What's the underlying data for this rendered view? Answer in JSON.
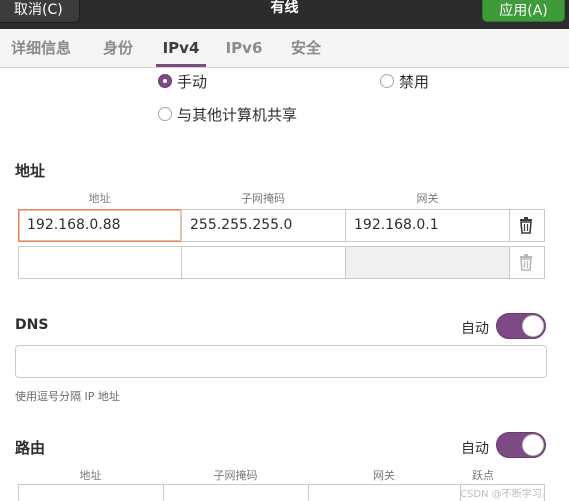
{
  "header": {
    "cancel_label": "取消(C)",
    "title": "有线",
    "apply_label": "应用(A)",
    "apply_color": "#3f9a3a"
  },
  "tabs": [
    {
      "label": "详细信息",
      "active": false
    },
    {
      "label": "身份",
      "active": false
    },
    {
      "label": "IPv4",
      "active": true
    },
    {
      "label": "IPv6",
      "active": false
    },
    {
      "label": "安全",
      "active": false
    }
  ],
  "method": {
    "options": [
      {
        "label": "手动",
        "selected": true
      },
      {
        "label": "禁用",
        "selected": false
      },
      {
        "label": "与其他计算机共享",
        "selected": false
      }
    ]
  },
  "addresses": {
    "heading": "地址",
    "columns": [
      "地址",
      "子网掩码",
      "网关"
    ],
    "rows": [
      {
        "address": "192.168.0.88",
        "netmask": "255.255.255.0",
        "gateway": "192.168.0.1"
      },
      {
        "address": "",
        "netmask": "",
        "gateway": ""
      }
    ],
    "delete_icon": "trash-icon"
  },
  "dns": {
    "heading": "DNS",
    "auto_label": "自动",
    "auto_on": true,
    "value": "",
    "hint": "使用逗号分隔 IP 地址"
  },
  "routes": {
    "heading": "路由",
    "auto_label": "自动",
    "auto_on": true,
    "columns": [
      "地址",
      "子网掩码",
      "网关",
      "跃点"
    ]
  },
  "accent_color": "#7e4a86",
  "watermark": "CSDN @不断学习。"
}
